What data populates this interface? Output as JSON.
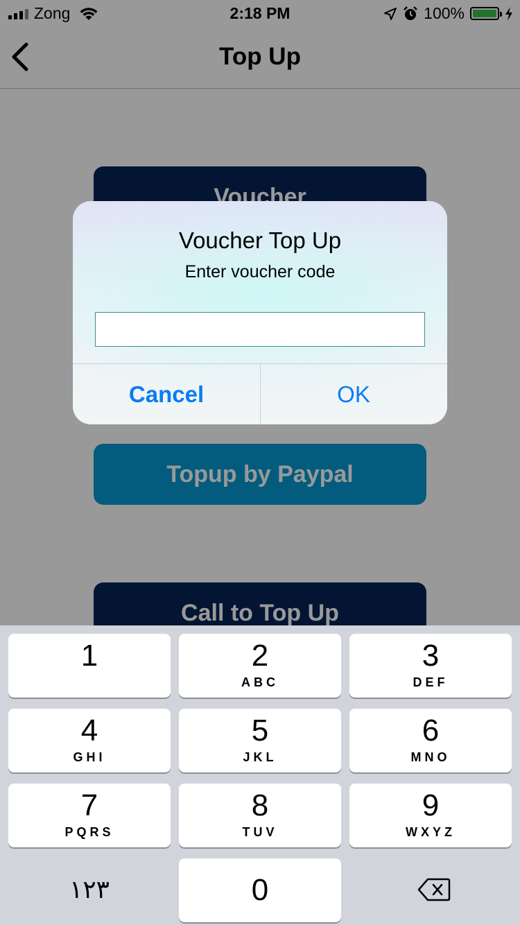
{
  "status_bar": {
    "carrier": "Zong",
    "time": "2:18 PM",
    "battery": "100%"
  },
  "nav": {
    "title": "Top Up",
    "back_icon": "chevron-left-icon"
  },
  "buttons": {
    "voucher": "Voucher",
    "paypal": "Topup by Paypal",
    "call": "Call to Top Up"
  },
  "alert": {
    "title": "Voucher Top Up",
    "message": "Enter voucher code",
    "input_value": "",
    "cancel": "Cancel",
    "ok": "OK"
  },
  "keypad": {
    "keys": [
      {
        "num": "1",
        "letters": ""
      },
      {
        "num": "2",
        "letters": "ABC"
      },
      {
        "num": "3",
        "letters": "DEF"
      },
      {
        "num": "4",
        "letters": "GHI"
      },
      {
        "num": "5",
        "letters": "JKL"
      },
      {
        "num": "6",
        "letters": "MNO"
      },
      {
        "num": "7",
        "letters": "PQRS"
      },
      {
        "num": "8",
        "letters": "TUV"
      },
      {
        "num": "9",
        "letters": "WXYZ"
      },
      {
        "num": "0",
        "letters": ""
      }
    ],
    "alt_key": "١٢٣",
    "delete_icon": "backspace-icon"
  },
  "colors": {
    "navy": "#062456",
    "paypal_blue": "#0599d2",
    "ios_blue": "#0a7cf4",
    "battery_green": "#3cc04a"
  }
}
